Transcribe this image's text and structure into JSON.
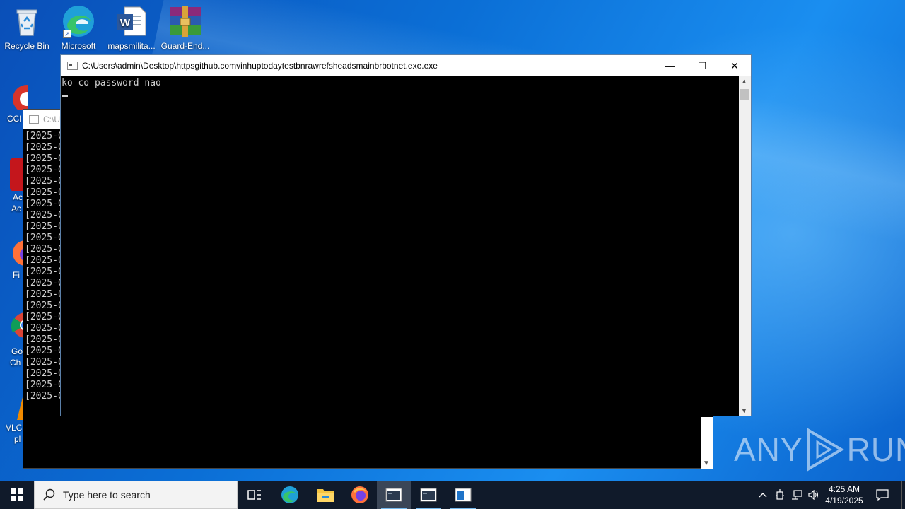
{
  "desktop": {
    "icons": [
      {
        "label": "Recycle Bin"
      },
      {
        "label": "Microsoft"
      },
      {
        "label": "mapsmilita..."
      },
      {
        "label": "Guard-End..."
      }
    ],
    "side_partial_labels": [
      "CCl",
      "Ac",
      "Ac",
      "Fi",
      "Go",
      "Ch",
      "VLC",
      "pl"
    ]
  },
  "background_console": {
    "title": "C:\\U",
    "log_prefix": "[2025-0",
    "line_count": 24
  },
  "foreground_console": {
    "title": "C:\\Users\\admin\\Desktop\\httpsgithub.comvinhuptodaytestbnrawrefsheadsmainbrbotnet.exe.exe",
    "output_line": "ko co password nao",
    "minimize_icon": "—",
    "maximize_icon": "☐",
    "close_icon": "✕"
  },
  "watermark": {
    "left": "ANY",
    "right": "RUN"
  },
  "taskbar": {
    "search_placeholder": "Type here to search",
    "clock_time": "4:25 AM",
    "clock_date": "4/19/2025"
  },
  "colors": {
    "taskbar": "#101a2a",
    "console_bg": "#000000",
    "console_text": "#d0d0d0",
    "desktop_blue": "#0b6fd6"
  }
}
